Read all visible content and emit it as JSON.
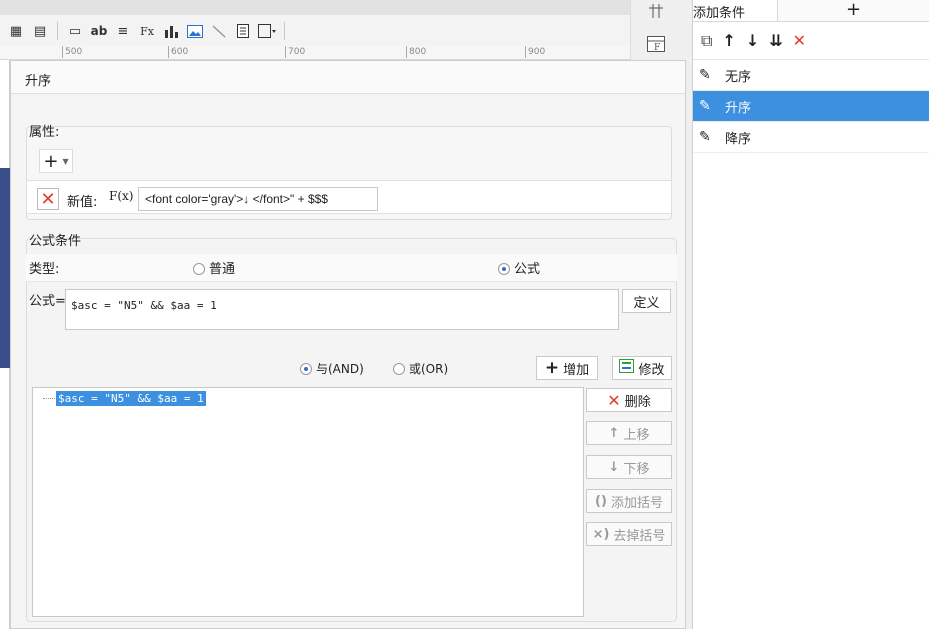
{
  "ruler": [
    "500",
    "600",
    "700",
    "800",
    "900"
  ],
  "side_icons": [
    "layout-icon",
    "formula-cell-icon"
  ],
  "right_panel": {
    "header": "添加条件",
    "add_symbol": "+",
    "tool_symbols": {
      "copy": "⧉",
      "up": "↑",
      "down": "↓",
      "bottom": "⇊",
      "delete": "✕"
    },
    "items": [
      {
        "label": "无序",
        "selected": false
      },
      {
        "label": "升序",
        "selected": true
      },
      {
        "label": "降序",
        "selected": false
      }
    ]
  },
  "dialog": {
    "title": "升序",
    "props": {
      "label": "属性:",
      "add_symbol": "+",
      "delete_symbol": "✕",
      "new_value_label": "新值:",
      "fx_label": "F(x)",
      "value": "<font color='gray'>↓ </font>\" + $$$"
    },
    "formula_cond": {
      "label": "公式条件",
      "type_label": "类型:",
      "opt_normal": "普通",
      "opt_formula": "公式",
      "formula_label": "公式=",
      "formula_text": "$asc = \"N5\" && $aa = 1",
      "define_btn": "定义"
    },
    "logic": {
      "and_label": "与(AND)",
      "or_label": "或(OR)",
      "add_btn": "增加",
      "modify_btn": "修改"
    },
    "condition_list": [
      "$asc = \"N5\" && $aa = 1"
    ],
    "side_buttons": {
      "delete": "删除",
      "up": "上移",
      "down": "下移",
      "add_paren": "添加括号",
      "remove_paren": "去掉括号"
    }
  },
  "colors": {
    "selected": "#3d8fe0",
    "delete_red": "#e23b2e",
    "accent_green": "#2e9e3a"
  }
}
